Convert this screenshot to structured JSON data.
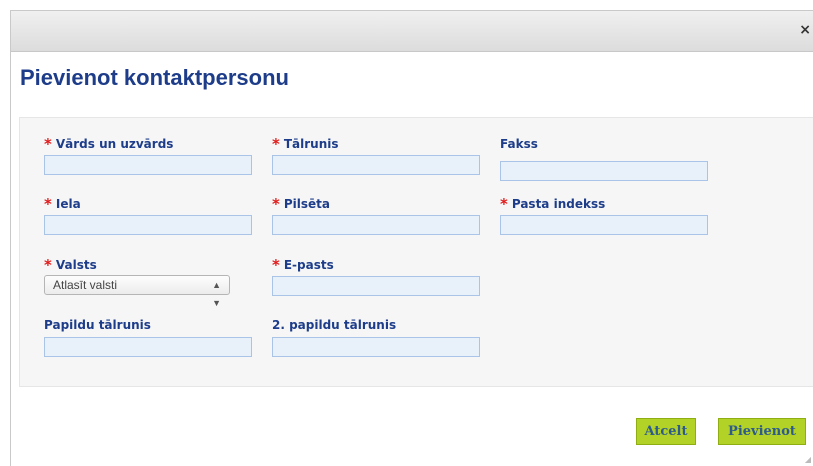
{
  "dialog": {
    "close_icon": "×",
    "title": "Pievienot kontaktpersonu"
  },
  "form": {
    "required_mark": "*",
    "full_name": {
      "label": "Vārds un uzvārds",
      "value": ""
    },
    "phone": {
      "label": "Tālrunis",
      "value": ""
    },
    "fax": {
      "label": "Fakss",
      "value": ""
    },
    "street": {
      "label": "Iela",
      "value": ""
    },
    "city": {
      "label": "Pilsēta",
      "value": ""
    },
    "postal_code": {
      "label": "Pasta indekss",
      "value": ""
    },
    "country": {
      "label": "Valsts",
      "selected": "Atlasīt valsti"
    },
    "email": {
      "label": "E-pasts",
      "value": ""
    },
    "extra_phone": {
      "label": "Papildu tālrunis",
      "value": ""
    },
    "extra_phone_2": {
      "label": "2. papildu tālrunis",
      "value": ""
    }
  },
  "buttons": {
    "cancel": "Atcelt",
    "add": "Pievienot"
  }
}
